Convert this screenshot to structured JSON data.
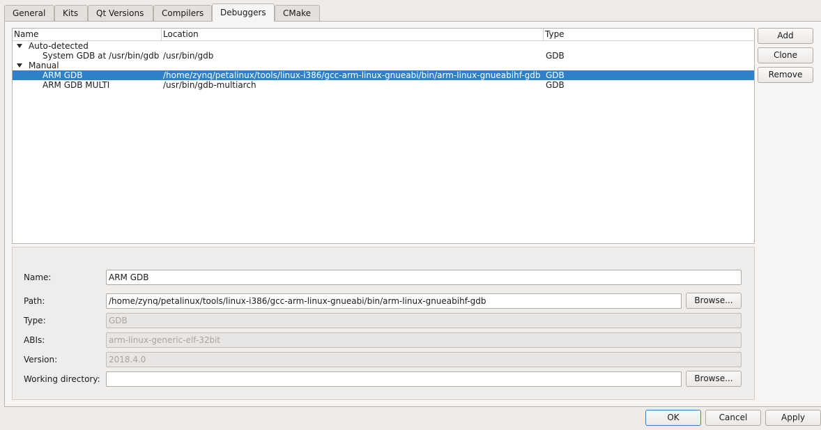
{
  "tabs": [
    {
      "label": "General"
    },
    {
      "label": "Kits"
    },
    {
      "label": "Qt Versions"
    },
    {
      "label": "Compilers"
    },
    {
      "label": "Debuggers"
    },
    {
      "label": "CMake"
    }
  ],
  "active_tab": "Debuggers",
  "tree": {
    "columns": [
      "Name",
      "Location",
      "Type"
    ],
    "groups": [
      {
        "label": "Auto-detected",
        "rows": [
          {
            "name": "System GDB at /usr/bin/gdb",
            "location": "/usr/bin/gdb",
            "type": "GDB"
          }
        ]
      },
      {
        "label": "Manual",
        "rows": [
          {
            "name": "ARM GDB",
            "location": "/home/zynq/petalinux/tools/linux-i386/gcc-arm-linux-gnueabi/bin/arm-linux-gnueabihf-gdb",
            "type": "GDB",
            "selected": true
          },
          {
            "name": "ARM GDB MULTI",
            "location": "/usr/bin/gdb-multiarch",
            "type": "GDB"
          }
        ]
      }
    ]
  },
  "side_buttons": {
    "add": "Add",
    "clone": "Clone",
    "remove": "Remove"
  },
  "details": {
    "name_label": "Name:",
    "name_value": "ARM GDB",
    "path_label": "Path:",
    "path_value": "/home/zynq/petalinux/tools/linux-i386/gcc-arm-linux-gnueabi/bin/arm-linux-gnueabihf-gdb",
    "browse_label": "Browse...",
    "type_label": "Type:",
    "type_value": "GDB",
    "abis_label": "ABIs:",
    "abis_value": "arm-linux-generic-elf-32bit",
    "version_label": "Version:",
    "version_value": "2018.4.0",
    "workdir_label": "Working directory:",
    "workdir_value": ""
  },
  "dialog_buttons": {
    "ok": "OK",
    "cancel": "Cancel",
    "apply": "Apply"
  },
  "colors": {
    "selection": "#3080c8",
    "window_bg": "#efebe7"
  }
}
